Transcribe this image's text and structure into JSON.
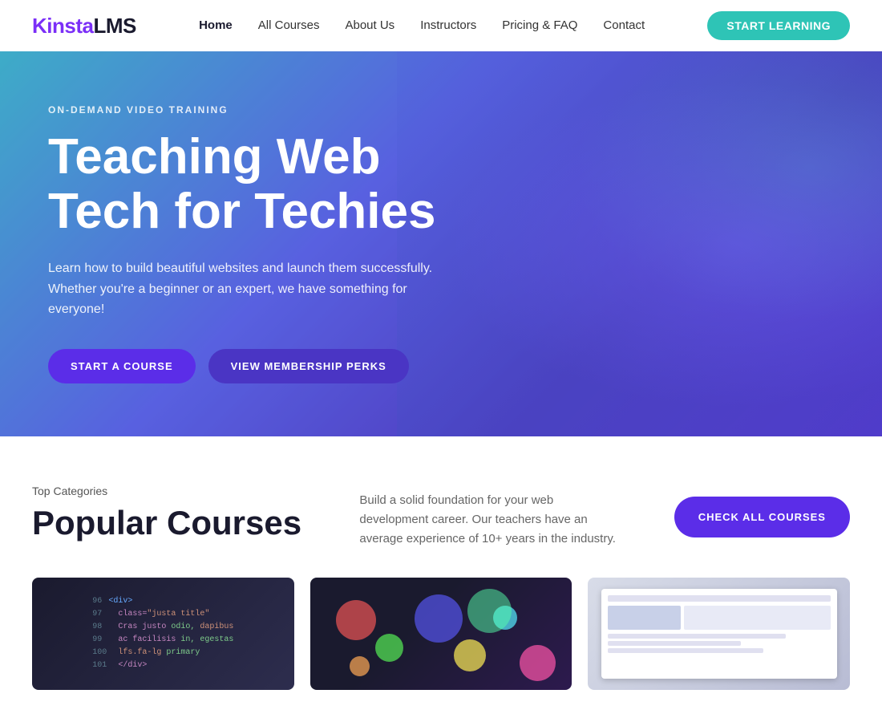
{
  "nav": {
    "logo_kinsta": "Kinsta",
    "logo_lms": "LMS",
    "links": [
      {
        "label": "Home",
        "active": true
      },
      {
        "label": "All Courses",
        "active": false
      },
      {
        "label": "About Us",
        "active": false
      },
      {
        "label": "Instructors",
        "active": false
      },
      {
        "label": "Pricing & FAQ",
        "active": false
      },
      {
        "label": "Contact",
        "active": false
      }
    ],
    "cta_label": "START LEARNING"
  },
  "hero": {
    "eyebrow": "ON-DEMAND VIDEO TRAINING",
    "title_line1": "Teaching Web",
    "title_line2": "Tech for Techies",
    "subtitle": "Learn how to build beautiful websites and launch them successfully. Whether you're a beginner or an expert, we have something for everyone!",
    "btn_primary": "START A COURSE",
    "btn_secondary": "VIEW MEMBERSHIP PERKS"
  },
  "courses_section": {
    "eyebrow": "Top Categories",
    "title": "Popular Courses",
    "description": "Build a solid foundation for your web development career. Our teachers have an average experience of 10+ years in the industry.",
    "btn_check": "CHECK ALL COURSES"
  }
}
